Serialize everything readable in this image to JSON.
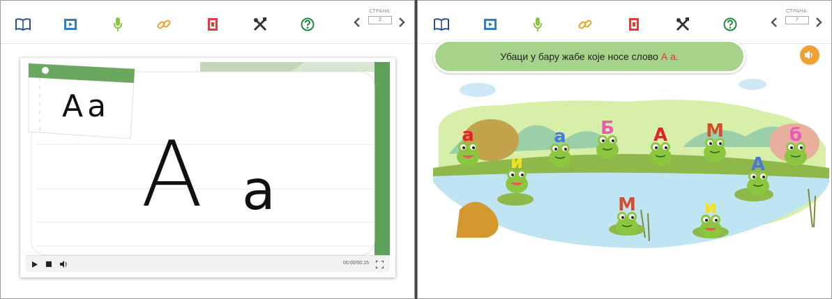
{
  "left": {
    "toolbar": {
      "icons": [
        "book-icon",
        "film-icon",
        "microphone-icon",
        "link-icon",
        "notebook-icon",
        "tools-icon",
        "help-icon"
      ]
    },
    "pager": {
      "label": "СТРАНА:",
      "page": "2"
    },
    "video": {
      "card_letters": "Aa",
      "big_upper": "A",
      "big_lower": "a",
      "time": "00:00/00:15"
    }
  },
  "right": {
    "toolbar": {
      "icons": [
        "book-icon",
        "film-icon",
        "microphone-icon",
        "link-icon",
        "notebook-icon",
        "tools-icon",
        "help-icon"
      ]
    },
    "pager": {
      "label": "СТРАНА:",
      "page": "7"
    },
    "instruction": {
      "text": "Убаци у бару жабе које носе слово",
      "highlight": "А а."
    },
    "frogs": [
      {
        "letter": "а",
        "color": "#e8202a"
      },
      {
        "letter": "и",
        "color": "#f2e21e"
      },
      {
        "letter": "а",
        "color": "#4a78d8"
      },
      {
        "letter": "Б",
        "color": "#e85ab8"
      },
      {
        "letter": "А",
        "color": "#e8202a"
      },
      {
        "letter": "М",
        "color": "#d0502e"
      },
      {
        "letter": "А",
        "color": "#4a78d8"
      },
      {
        "letter": "б",
        "color": "#e85ab8"
      },
      {
        "letter": "М",
        "color": "#d0502e"
      },
      {
        "letter": "и",
        "color": "#f2e21e"
      }
    ]
  }
}
